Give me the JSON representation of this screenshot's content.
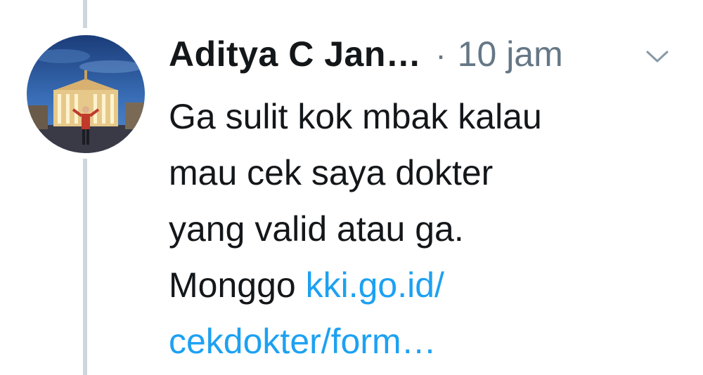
{
  "tweet": {
    "author_name": "Aditya C Jan…",
    "separator": "·",
    "timestamp": "10 jam",
    "text_lines": [
      "Ga sulit kok mbak kalau",
      "mau cek saya dokter",
      "yang valid atau ga."
    ],
    "text_prefix_last": "Monggo ",
    "link_line1": "kki.go.id/",
    "link_line2": "cekdokter/form…"
  },
  "icons": {
    "menu": "chevron-down-icon",
    "avatar": "avatar-photo"
  },
  "colors": {
    "text": "#14171a",
    "muted": "#657786",
    "link": "#1da1f2",
    "thread_line": "#cdd6dd"
  }
}
